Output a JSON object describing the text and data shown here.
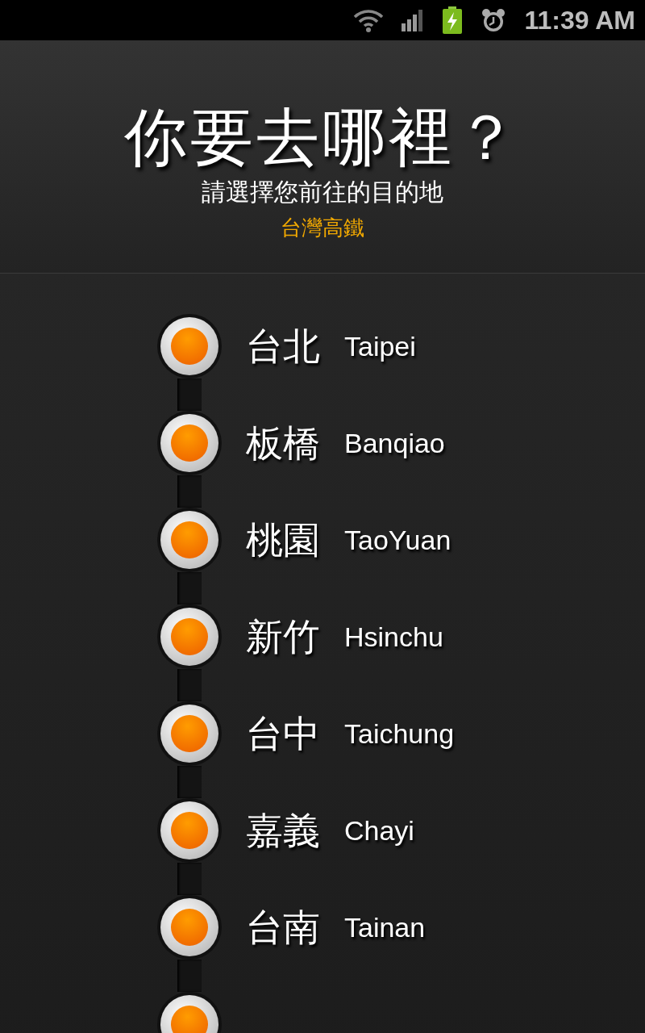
{
  "status_bar": {
    "time": "11:39 AM"
  },
  "header": {
    "title": "你要去哪裡？",
    "subtitle": "請選擇您前往的目的地",
    "operator": "台灣高鐵"
  },
  "stations": [
    {
      "kind": "labeled",
      "name_zh": "台北",
      "name_en": "Taipei"
    },
    {
      "kind": "labeled",
      "name_zh": "板橋",
      "name_en": "Banqiao"
    },
    {
      "kind": "labeled",
      "name_zh": "桃園",
      "name_en": "TaoYuan"
    },
    {
      "kind": "labeled",
      "name_zh": "新竹",
      "name_en": "Hsinchu"
    },
    {
      "kind": "labeled",
      "name_zh": "台中",
      "name_en": "Taichung"
    },
    {
      "kind": "labeled",
      "name_zh": "嘉義",
      "name_en": "Chayi"
    },
    {
      "kind": "labeled",
      "name_zh": "台南",
      "name_en": "Tainan"
    },
    {
      "kind": "cut_off"
    }
  ]
}
